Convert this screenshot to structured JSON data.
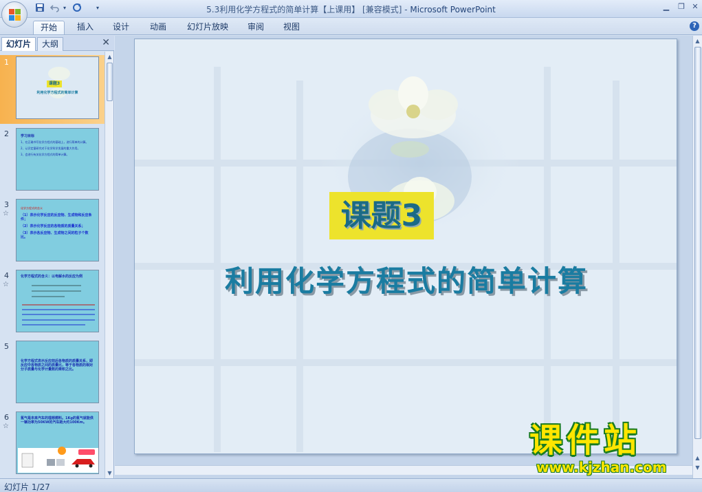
{
  "window": {
    "title_file": "5.3利用化学方程式的简单计算【上课用】 [兼容模式] - ",
    "title_app": "Microsoft PowerPoint"
  },
  "ribbon": {
    "tabs": [
      "开始",
      "插入",
      "设计",
      "动画",
      "幻灯片放映",
      "审阅",
      "视图"
    ],
    "active_tab": "开始"
  },
  "pane": {
    "tabs": [
      "幻灯片",
      "大纲"
    ],
    "active_tab": "幻灯片"
  },
  "slides": [
    {
      "num": "1",
      "selected": true,
      "has_star": false
    },
    {
      "num": "2",
      "selected": false,
      "has_star": false
    },
    {
      "num": "3",
      "selected": false,
      "has_star": true
    },
    {
      "num": "4",
      "selected": false,
      "has_star": true
    },
    {
      "num": "5",
      "selected": false,
      "has_star": false
    },
    {
      "num": "6",
      "selected": false,
      "has_star": true
    }
  ],
  "thumbs": {
    "t1_badge": "课题3",
    "t1_title": "利用化学方程式的简单计算",
    "t2_head": "学习目标",
    "t2_lines": [
      "1、在正确书写化学方程式的基础上，进行简单的计算。",
      "2、认识定量研究对于化学科学发展的重大作用。",
      "3、会进行有关化学方程式的简单计算。"
    ],
    "t3_head": "化学方程式的含义",
    "t3_lines": [
      "（1）表示化学反应的反应物、生成物和反应条件；",
      "（2）表示化学反应的各物质的质量关系；",
      "（3）表示各反应物、生成物之间的粒子个数比。"
    ],
    "t4_head": "化学方程式的含义：以电解水的反应为例",
    "t5_text": "化学方程式表示反应前后各物质的质量关系，即反应中各物质之间的质量比，等于各物质的相对分子质量与化学计量数的乘积之比。",
    "t6_text": "氢气是未来汽车的理想燃料。1Kg的氢气就能供一辆功率为50KW的汽车跑大约100Km。"
  },
  "slide": {
    "badge": "课题3",
    "title": "利用化学方程式的简单计算"
  },
  "status": {
    "slide_counter": "幻灯片 1/27"
  },
  "watermark": {
    "big": "课件站",
    "url": "www.kjzhan.com"
  },
  "colors": {
    "badge_bg": "#ede32c",
    "title_color": "#1a7ca1",
    "selected_thumb": "#f7b24f",
    "thumb_bg": "#81cde0"
  }
}
